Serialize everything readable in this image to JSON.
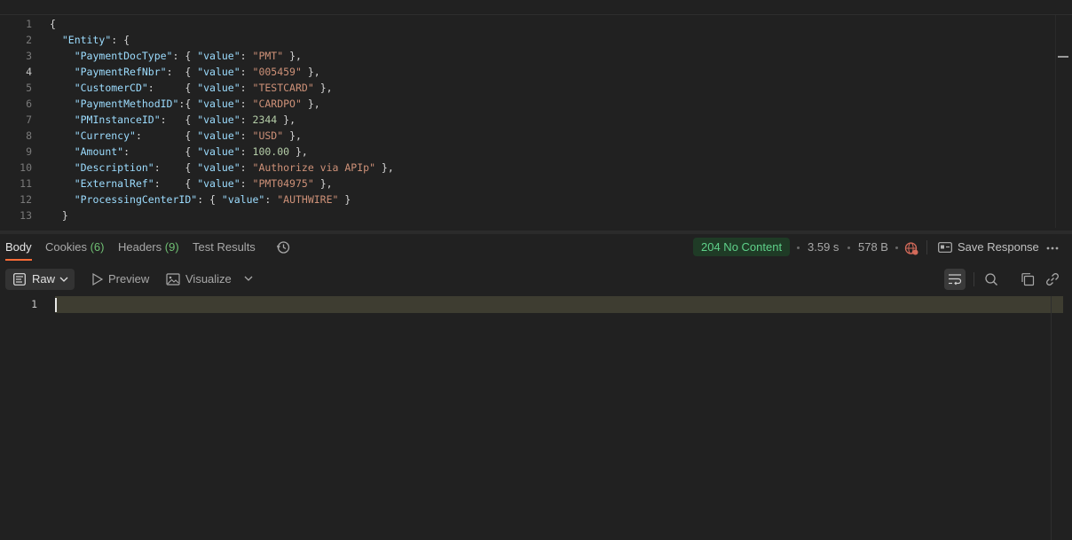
{
  "request_body": {
    "lines": [
      {
        "n": "1",
        "tokens": [
          {
            "t": "p",
            "v": "{"
          }
        ]
      },
      {
        "n": "2",
        "tokens": [
          {
            "t": "p",
            "v": "  "
          },
          {
            "t": "k",
            "v": "\"Entity\""
          },
          {
            "t": "p",
            "v": ": {"
          }
        ]
      },
      {
        "n": "3",
        "tokens": [
          {
            "t": "p",
            "v": "    "
          },
          {
            "t": "k",
            "v": "\"PaymentDocType\""
          },
          {
            "t": "p",
            "v": ": { "
          },
          {
            "t": "k",
            "v": "\"value\""
          },
          {
            "t": "p",
            "v": ": "
          },
          {
            "t": "s",
            "v": "\"PMT\""
          },
          {
            "t": "p",
            "v": " },"
          }
        ]
      },
      {
        "n": "4",
        "tokens": [
          {
            "t": "p",
            "v": "    "
          },
          {
            "t": "k",
            "v": "\"PaymentRefNbr\""
          },
          {
            "t": "p",
            "v": ":  { "
          },
          {
            "t": "k",
            "v": "\"value\""
          },
          {
            "t": "p",
            "v": ": "
          },
          {
            "t": "s",
            "v": "\"005459\""
          },
          {
            "t": "p",
            "v": " },"
          }
        ]
      },
      {
        "n": "5",
        "tokens": [
          {
            "t": "p",
            "v": "    "
          },
          {
            "t": "k",
            "v": "\"CustomerCD\""
          },
          {
            "t": "p",
            "v": ":     { "
          },
          {
            "t": "k",
            "v": "\"value\""
          },
          {
            "t": "p",
            "v": ": "
          },
          {
            "t": "s",
            "v": "\"TESTCARD\""
          },
          {
            "t": "p",
            "v": " },"
          }
        ]
      },
      {
        "n": "6",
        "tokens": [
          {
            "t": "p",
            "v": "    "
          },
          {
            "t": "k",
            "v": "\"PaymentMethodID\""
          },
          {
            "t": "p",
            "v": ":{ "
          },
          {
            "t": "k",
            "v": "\"value\""
          },
          {
            "t": "p",
            "v": ": "
          },
          {
            "t": "s",
            "v": "\"CARDPO\""
          },
          {
            "t": "p",
            "v": " },"
          }
        ]
      },
      {
        "n": "7",
        "tokens": [
          {
            "t": "p",
            "v": "    "
          },
          {
            "t": "k",
            "v": "\"PMInstanceID\""
          },
          {
            "t": "p",
            "v": ":   { "
          },
          {
            "t": "k",
            "v": "\"value\""
          },
          {
            "t": "p",
            "v": ": "
          },
          {
            "t": "n",
            "v": "2344"
          },
          {
            "t": "p",
            "v": " },"
          }
        ]
      },
      {
        "n": "8",
        "tokens": [
          {
            "t": "p",
            "v": "    "
          },
          {
            "t": "k",
            "v": "\"Currency\""
          },
          {
            "t": "p",
            "v": ":       { "
          },
          {
            "t": "k",
            "v": "\"value\""
          },
          {
            "t": "p",
            "v": ": "
          },
          {
            "t": "s",
            "v": "\"USD\""
          },
          {
            "t": "p",
            "v": " },"
          }
        ]
      },
      {
        "n": "9",
        "tokens": [
          {
            "t": "p",
            "v": "    "
          },
          {
            "t": "k",
            "v": "\"Amount\""
          },
          {
            "t": "p",
            "v": ":         { "
          },
          {
            "t": "k",
            "v": "\"value\""
          },
          {
            "t": "p",
            "v": ": "
          },
          {
            "t": "n",
            "v": "100.00"
          },
          {
            "t": "p",
            "v": " },"
          }
        ]
      },
      {
        "n": "10",
        "tokens": [
          {
            "t": "p",
            "v": "    "
          },
          {
            "t": "k",
            "v": "\"Description\""
          },
          {
            "t": "p",
            "v": ":    { "
          },
          {
            "t": "k",
            "v": "\"value\""
          },
          {
            "t": "p",
            "v": ": "
          },
          {
            "t": "s",
            "v": "\"Authorize via APIp\""
          },
          {
            "t": "p",
            "v": " },"
          }
        ]
      },
      {
        "n": "11",
        "tokens": [
          {
            "t": "p",
            "v": "    "
          },
          {
            "t": "k",
            "v": "\"ExternalRef\""
          },
          {
            "t": "p",
            "v": ":    { "
          },
          {
            "t": "k",
            "v": "\"value\""
          },
          {
            "t": "p",
            "v": ": "
          },
          {
            "t": "s",
            "v": "\"PMT04975\""
          },
          {
            "t": "p",
            "v": " },"
          }
        ]
      },
      {
        "n": "12",
        "tokens": [
          {
            "t": "p",
            "v": "    "
          },
          {
            "t": "k",
            "v": "\"ProcessingCenterID\""
          },
          {
            "t": "p",
            "v": ": { "
          },
          {
            "t": "k",
            "v": "\"value\""
          },
          {
            "t": "p",
            "v": ": "
          },
          {
            "t": "s",
            "v": "\"AUTHWIRE\""
          },
          {
            "t": "p",
            "v": " }"
          }
        ]
      },
      {
        "n": "13",
        "tokens": [
          {
            "t": "p",
            "v": "  }"
          }
        ]
      }
    ],
    "active_line": "4"
  },
  "response_tabs": {
    "body": "Body",
    "cookies": "Cookies",
    "cookies_count": "(6)",
    "headers": "Headers",
    "headers_count": "(9)",
    "test_results": "Test Results"
  },
  "status": {
    "code_text": "204 No Content",
    "time": "3.59 s",
    "size": "578 B",
    "save_response": "Save Response"
  },
  "toolbar": {
    "raw": "Raw",
    "preview": "Preview",
    "visualize": "Visualize"
  },
  "response_body": {
    "line_number": "1"
  },
  "colors": {
    "accent": "#ff6c37",
    "status_green": "#5fd18a",
    "key": "#9cdcfe",
    "string": "#ce9178",
    "number": "#b5cea8"
  }
}
